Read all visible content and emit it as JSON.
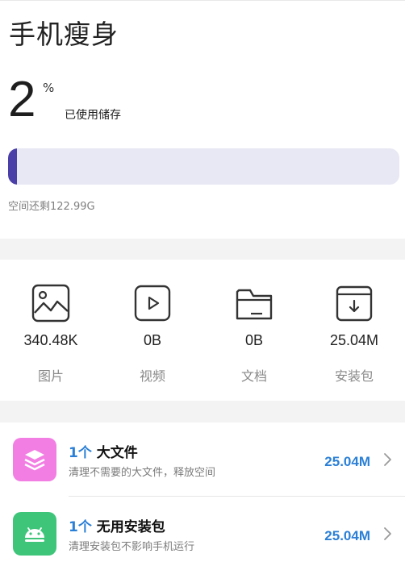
{
  "page": {
    "title": "手机瘦身"
  },
  "storage": {
    "percent": "2",
    "percent_sign": "%",
    "used_label": "已使用储存",
    "used_fraction": 0.02,
    "remaining": "空间还剩122.99G",
    "bar_color": "#4a3fa8",
    "track_color": "#e8e8f4"
  },
  "categories": [
    {
      "icon": "image-icon",
      "size": "340.48K",
      "label": "图片"
    },
    {
      "icon": "video-icon",
      "size": "0B",
      "label": "视频"
    },
    {
      "icon": "folder-icon",
      "size": "0B",
      "label": "文档"
    },
    {
      "icon": "package-icon",
      "size": "25.04M",
      "label": "安装包"
    }
  ],
  "items": [
    {
      "icon": "layers-icon",
      "icon_color": "#f27ee3",
      "count": "1个",
      "name": "大文件",
      "desc": "清理不需要的大文件，释放空间",
      "amount": "25.04M"
    },
    {
      "icon": "android-icon",
      "icon_color": "#3ec57a",
      "count": "1个",
      "name": "无用安装包",
      "desc": "清理安装包不影响手机运行",
      "amount": "25.04M"
    }
  ],
  "colors": {
    "accent": "#2a7fd6"
  }
}
